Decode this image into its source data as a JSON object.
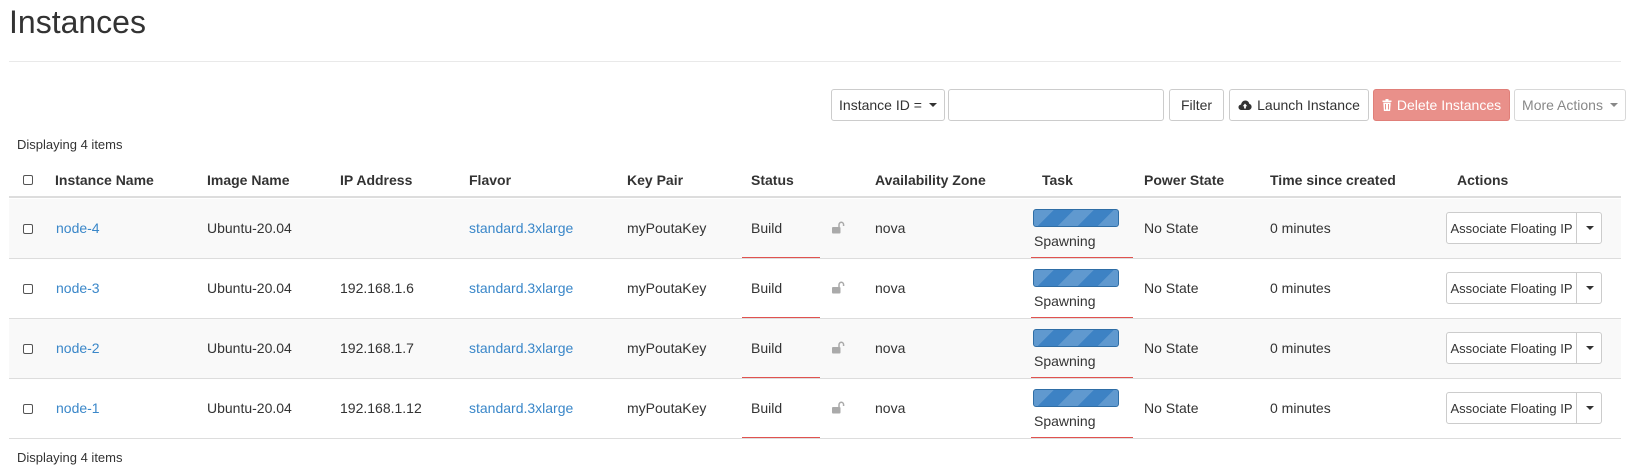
{
  "page": {
    "title": "Instances"
  },
  "toolbar": {
    "filter_field": "Instance ID =",
    "filter_value": "",
    "filter_label": "Filter",
    "launch_label": "Launch Instance",
    "delete_label": "Delete Instances",
    "more_label": "More Actions"
  },
  "summary": {
    "top": "Displaying 4 items",
    "bottom": "Displaying 4 items"
  },
  "table": {
    "columns": [
      "Instance Name",
      "Image Name",
      "IP Address",
      "Flavor",
      "Key Pair",
      "Status",
      "Availability Zone",
      "Task",
      "Power State",
      "Time since created",
      "Actions"
    ],
    "rows": [
      {
        "name": "node-4",
        "image": "Ubuntu-20.04",
        "ip": "",
        "flavor": "standard.3xlarge",
        "key_pair": "myPoutaKey",
        "status": "Build",
        "zone": "nova",
        "task": "Spawning",
        "power": "No State",
        "age": "0 minutes",
        "action": "Associate Floating IP"
      },
      {
        "name": "node-3",
        "image": "Ubuntu-20.04",
        "ip": "192.168.1.6",
        "flavor": "standard.3xlarge",
        "key_pair": "myPoutaKey",
        "status": "Build",
        "zone": "nova",
        "task": "Spawning",
        "power": "No State",
        "age": "0 minutes",
        "action": "Associate Floating IP"
      },
      {
        "name": "node-2",
        "image": "Ubuntu-20.04",
        "ip": "192.168.1.7",
        "flavor": "standard.3xlarge",
        "key_pair": "myPoutaKey",
        "status": "Build",
        "zone": "nova",
        "task": "Spawning",
        "power": "No State",
        "age": "0 minutes",
        "action": "Associate Floating IP"
      },
      {
        "name": "node-1",
        "image": "Ubuntu-20.04",
        "ip": "192.168.1.12",
        "flavor": "standard.3xlarge",
        "key_pair": "myPoutaKey",
        "status": "Build",
        "zone": "nova",
        "task": "Spawning",
        "power": "No State",
        "age": "0 minutes",
        "action": "Associate Floating IP"
      }
    ]
  },
  "colors": {
    "link": "#3a87c9",
    "danger": "#e9908a",
    "progress": "#3d82c4",
    "status_underline": "#e0524f"
  },
  "icons": {
    "launch": "cloud-upload-icon",
    "delete": "trash-icon",
    "lock": "unlocked-icon",
    "caret": "caret-down-icon"
  }
}
